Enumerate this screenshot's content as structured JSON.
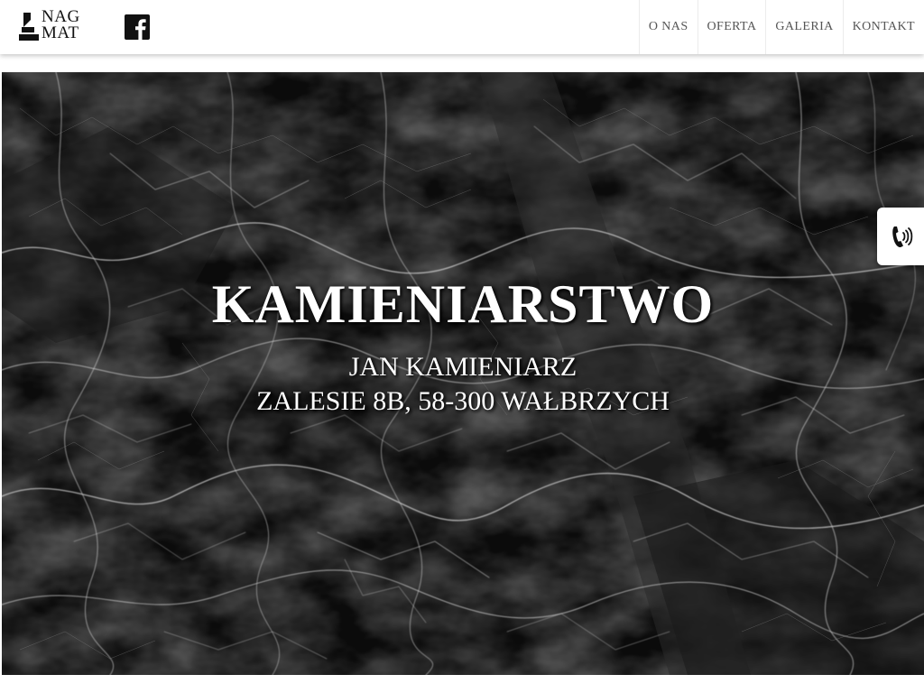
{
  "brand": {
    "logo_line1": "NAG",
    "logo_line2": "MAT",
    "text_color": "#111111"
  },
  "social": {
    "facebook_icon": "facebook-icon"
  },
  "nav": {
    "items": [
      {
        "label": "O NAS"
      },
      {
        "label": "OFERTA"
      },
      {
        "label": "GALERIA"
      },
      {
        "label": "KONTAKT"
      }
    ],
    "text_color": "#555555"
  },
  "hero": {
    "title": "KAMIENIARSTWO",
    "subtitle_line1": "JAN KAMIENIARZ",
    "subtitle_line2": "ZALESIE 8B, 58-300 WAŁBRZYCH",
    "background": "black marble texture",
    "text_color": "#ffffff"
  },
  "contact_tab": {
    "icon": "phone-icon"
  }
}
